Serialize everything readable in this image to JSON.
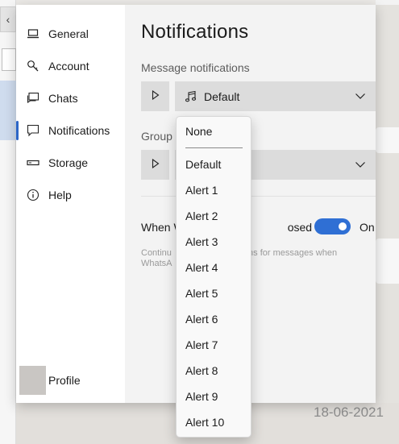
{
  "background": {
    "date_text": "18-06-2021",
    "top_button_glyph": "‹"
  },
  "nav": {
    "items": [
      {
        "label": "General",
        "icon": "laptop-icon"
      },
      {
        "label": "Account",
        "icon": "key-icon"
      },
      {
        "label": "Chats",
        "icon": "chat-bubble-icon"
      },
      {
        "label": "Notifications",
        "icon": "message-bubble-icon",
        "active": true
      },
      {
        "label": "Storage",
        "icon": "storage-drive-icon"
      },
      {
        "label": "Help",
        "icon": "info-icon"
      }
    ],
    "profile_label": "Profile"
  },
  "content": {
    "title": "Notifications",
    "message_notifications_label": "Message notifications",
    "message_select_value": "Default",
    "group_label": "Group",
    "toggle_label_start": "When W",
    "toggle_label_end": "osed",
    "toggle_state": "On",
    "toggle_on": true,
    "description_line1": "Continu",
    "description_line1_end": "ctions for messages when",
    "description_line2": "WhatsA"
  },
  "dropdown": {
    "options": [
      "None",
      "Default",
      "Alert 1",
      "Alert 2",
      "Alert 3",
      "Alert 4",
      "Alert 5",
      "Alert 6",
      "Alert 7",
      "Alert 8",
      "Alert 9",
      "Alert 10"
    ]
  },
  "colors": {
    "accent": "#2c66c7",
    "toggle_on": "#2f6fd4",
    "panel_bg": "#f3f3f3",
    "nav_bg": "#ffffff"
  }
}
